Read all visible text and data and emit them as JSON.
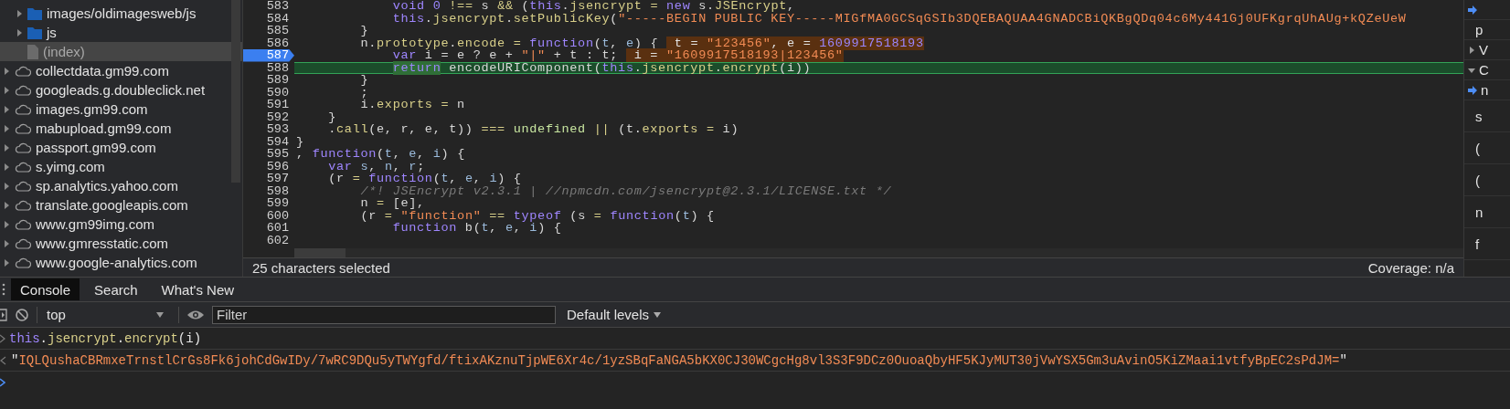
{
  "sidebar": {
    "items": [
      {
        "kind": "folder",
        "label": "images/oldimagesweb/js",
        "expanded": false,
        "selected": false
      },
      {
        "kind": "folder",
        "label": "js",
        "expanded": false,
        "selected": false
      },
      {
        "kind": "file",
        "label": "(index)",
        "selected": true
      },
      {
        "kind": "domain",
        "label": "collectdata.gm99.com",
        "expanded": false,
        "selected": false
      },
      {
        "kind": "domain",
        "label": "googleads.g.doubleclick.net",
        "expanded": false,
        "selected": false
      },
      {
        "kind": "domain",
        "label": "images.gm99.com",
        "expanded": false,
        "selected": false
      },
      {
        "kind": "domain",
        "label": "mabupload.gm99.com",
        "expanded": false,
        "selected": false
      },
      {
        "kind": "domain",
        "label": "passport.gm99.com",
        "expanded": false,
        "selected": false
      },
      {
        "kind": "domain",
        "label": "s.yimg.com",
        "expanded": false,
        "selected": false
      },
      {
        "kind": "domain",
        "label": "sp.analytics.yahoo.com",
        "expanded": false,
        "selected": false
      },
      {
        "kind": "domain",
        "label": "translate.googleapis.com",
        "expanded": false,
        "selected": false
      },
      {
        "kind": "domain",
        "label": "www.gm99img.com",
        "expanded": false,
        "selected": false
      },
      {
        "kind": "domain",
        "label": "www.gmresstatic.com",
        "expanded": false,
        "selected": false
      },
      {
        "kind": "domain",
        "label": "www.google-analytics.com",
        "expanded": false,
        "selected": false
      }
    ]
  },
  "editor": {
    "lines": [
      {
        "number": "583",
        "breakpoint": false,
        "paused": false,
        "tokens": [
          {
            "kind": "keyword",
            "text": "            void"
          },
          {
            "kind": "number",
            "text": " 0"
          },
          {
            "kind": "operator",
            "text": " !== "
          },
          {
            "kind": "plain",
            "text": "s"
          },
          {
            "kind": "operator",
            "text": " && "
          },
          {
            "kind": "plain",
            "text": "("
          },
          {
            "kind": "keyword",
            "text": "this"
          },
          {
            "kind": "plain",
            "text": "."
          },
          {
            "kind": "property",
            "text": "jsencrypt"
          },
          {
            "kind": "operator",
            "text": " = "
          },
          {
            "kind": "keyword",
            "text": "new"
          },
          {
            "kind": "plain",
            "text": " s."
          },
          {
            "kind": "property",
            "text": "JSEncrypt"
          },
          {
            "kind": "plain",
            "text": ","
          }
        ]
      },
      {
        "number": "584",
        "breakpoint": false,
        "paused": false,
        "tokens": [
          {
            "kind": "keyword",
            "text": "            this"
          },
          {
            "kind": "plain",
            "text": "."
          },
          {
            "kind": "property",
            "text": "jsencrypt"
          },
          {
            "kind": "plain",
            "text": "."
          },
          {
            "kind": "property",
            "text": "setPublicKey"
          },
          {
            "kind": "plain",
            "text": "("
          },
          {
            "kind": "string",
            "text": "\"-----BEGIN PUBLIC KEY-----MIGfMA0GCSqGSIb3DQEBAQUAA4GNADCBiQKBgQDq04c6My441Gj0UFKgrqUhAUg+kQZeUeW"
          }
        ]
      },
      {
        "number": "585",
        "breakpoint": false,
        "paused": false,
        "tokens": [
          {
            "kind": "plain",
            "text": "        }"
          }
        ]
      },
      {
        "number": "586",
        "breakpoint": false,
        "paused": false,
        "tokens": [
          {
            "kind": "plain",
            "text": "        n."
          },
          {
            "kind": "property",
            "text": "prototype"
          },
          {
            "kind": "plain",
            "text": "."
          },
          {
            "kind": "property",
            "text": "encode"
          },
          {
            "kind": "operator",
            "text": " = "
          },
          {
            "kind": "keyword",
            "text": "function"
          },
          {
            "kind": "plain",
            "text": "("
          },
          {
            "kind": "variable",
            "text": "t"
          },
          {
            "kind": "plain",
            "text": ", "
          },
          {
            "kind": "variable",
            "text": "e"
          },
          {
            "kind": "plain",
            "text": ") { "
          }
        ],
        "inline_value": [
          {
            "kind": "plain",
            "text": " t = "
          },
          {
            "kind": "string",
            "text": "\"123456\""
          },
          {
            "kind": "plain",
            "text": ", e = "
          },
          {
            "kind": "number",
            "text": "1609917518193"
          }
        ]
      },
      {
        "number": "587",
        "breakpoint": true,
        "paused": false,
        "tokens": [
          {
            "kind": "keyword",
            "text": "            var"
          },
          {
            "kind": "plain",
            "text": " i = e ? e + "
          },
          {
            "kind": "string",
            "text": "\"|\""
          },
          {
            "kind": "plain",
            "text": " + t : t; "
          }
        ],
        "inline_value": [
          {
            "kind": "plain",
            "text": " i = "
          },
          {
            "kind": "string",
            "text": "\"1609917518193|123456\""
          }
        ]
      },
      {
        "number": "588",
        "breakpoint": false,
        "paused": true,
        "tokens": [
          {
            "kind": "keyword",
            "text": "            return",
            "highlighted": true
          },
          {
            "kind": "plain",
            "text": " encodeURIComponent("
          },
          {
            "kind": "keyword",
            "text": "this"
          },
          {
            "kind": "plain",
            "text": "."
          },
          {
            "kind": "property",
            "text": "jsencrypt"
          },
          {
            "kind": "plain",
            "text": "."
          },
          {
            "kind": "property",
            "text": "encrypt"
          },
          {
            "kind": "plain",
            "text": "(i))"
          }
        ]
      },
      {
        "number": "589",
        "breakpoint": false,
        "paused": false,
        "tokens": [
          {
            "kind": "plain",
            "text": "        }"
          }
        ]
      },
      {
        "number": "590",
        "breakpoint": false,
        "paused": false,
        "tokens": [
          {
            "kind": "plain",
            "text": "        ;"
          }
        ]
      },
      {
        "number": "591",
        "breakpoint": false,
        "paused": false,
        "tokens": [
          {
            "kind": "plain",
            "text": "        i."
          },
          {
            "kind": "property",
            "text": "exports"
          },
          {
            "kind": "operator",
            "text": " = "
          },
          {
            "kind": "plain",
            "text": "n"
          }
        ]
      },
      {
        "number": "592",
        "breakpoint": false,
        "paused": false,
        "tokens": [
          {
            "kind": "plain",
            "text": "    }"
          }
        ]
      },
      {
        "number": "593",
        "breakpoint": false,
        "paused": false,
        "tokens": [
          {
            "kind": "plain",
            "text": "    ."
          },
          {
            "kind": "property",
            "text": "call"
          },
          {
            "kind": "plain",
            "text": "(e, r, e, t)) "
          },
          {
            "kind": "operator",
            "text": "==="
          },
          {
            "kind": "literal",
            "text": " undefined "
          },
          {
            "kind": "operator",
            "text": "||"
          },
          {
            "kind": "plain",
            "text": " (t."
          },
          {
            "kind": "property",
            "text": "exports"
          },
          {
            "kind": "operator",
            "text": " = "
          },
          {
            "kind": "plain",
            "text": "i)"
          }
        ]
      },
      {
        "number": "594",
        "breakpoint": false,
        "paused": false,
        "tokens": [
          {
            "kind": "plain",
            "text": "}"
          }
        ]
      },
      {
        "number": "595",
        "breakpoint": false,
        "paused": false,
        "tokens": [
          {
            "kind": "plain",
            "text": ", "
          },
          {
            "kind": "keyword",
            "text": "function"
          },
          {
            "kind": "plain",
            "text": "("
          },
          {
            "kind": "variable",
            "text": "t"
          },
          {
            "kind": "plain",
            "text": ", "
          },
          {
            "kind": "variable",
            "text": "e"
          },
          {
            "kind": "plain",
            "text": ", "
          },
          {
            "kind": "variable",
            "text": "i"
          },
          {
            "kind": "plain",
            "text": ") {"
          }
        ]
      },
      {
        "number": "596",
        "breakpoint": false,
        "paused": false,
        "tokens": [
          {
            "kind": "keyword",
            "text": "    var"
          },
          {
            "kind": "variable",
            "text": " s"
          },
          {
            "kind": "plain",
            "text": ", "
          },
          {
            "kind": "variable",
            "text": "n"
          },
          {
            "kind": "plain",
            "text": ", "
          },
          {
            "kind": "variable",
            "text": "r"
          },
          {
            "kind": "plain",
            "text": ";"
          }
        ]
      },
      {
        "number": "597",
        "breakpoint": false,
        "paused": false,
        "tokens": [
          {
            "kind": "plain",
            "text": "    (r "
          },
          {
            "kind": "operator",
            "text": "="
          },
          {
            "kind": "keyword",
            "text": " function"
          },
          {
            "kind": "plain",
            "text": "("
          },
          {
            "kind": "variable",
            "text": "t"
          },
          {
            "kind": "plain",
            "text": ", "
          },
          {
            "kind": "variable",
            "text": "e"
          },
          {
            "kind": "plain",
            "text": ", "
          },
          {
            "kind": "variable",
            "text": "i"
          },
          {
            "kind": "plain",
            "text": ") {"
          }
        ]
      },
      {
        "number": "598",
        "breakpoint": false,
        "paused": false,
        "tokens": [
          {
            "kind": "comment",
            "text": "        /*! JSEncrypt v2.3.1 | //npmcdn.com/jsencrypt@2.3.1/LICENSE.txt */"
          }
        ]
      },
      {
        "number": "599",
        "breakpoint": false,
        "paused": false,
        "tokens": [
          {
            "kind": "plain",
            "text": "        n "
          },
          {
            "kind": "operator",
            "text": "="
          },
          {
            "kind": "plain",
            "text": " [e],"
          }
        ]
      },
      {
        "number": "600",
        "breakpoint": false,
        "paused": false,
        "tokens": [
          {
            "kind": "plain",
            "text": "        (r "
          },
          {
            "kind": "operator",
            "text": "="
          },
          {
            "kind": "string",
            "text": " \"function\""
          },
          {
            "kind": "operator",
            "text": " == "
          },
          {
            "kind": "keyword",
            "text": "typeof"
          },
          {
            "kind": "plain",
            "text": " (s "
          },
          {
            "kind": "operator",
            "text": "="
          },
          {
            "kind": "keyword",
            "text": " function"
          },
          {
            "kind": "plain",
            "text": "("
          },
          {
            "kind": "variable",
            "text": "t"
          },
          {
            "kind": "plain",
            "text": ") {"
          }
        ]
      },
      {
        "number": "601",
        "breakpoint": false,
        "paused": false,
        "tokens": [
          {
            "kind": "keyword",
            "text": "            function"
          },
          {
            "kind": "plain",
            "text": " b("
          },
          {
            "kind": "variable",
            "text": "t"
          },
          {
            "kind": "plain",
            "text": ", "
          },
          {
            "kind": "variable",
            "text": "e"
          },
          {
            "kind": "plain",
            "text": ", "
          },
          {
            "kind": "variable",
            "text": "i"
          },
          {
            "kind": "plain",
            "text": ") {"
          }
        ]
      },
      {
        "number": "602",
        "breakpoint": false,
        "paused": false
      }
    ]
  },
  "status_bar": {
    "selection": "25 characters selected",
    "coverage": "Coverage: n/a"
  },
  "right_panel": {
    "rows": [
      {
        "kind": "current"
      },
      {
        "kind": "plain",
        "text": "p"
      },
      {
        "kind": "section",
        "text": "V",
        "expanded": false
      },
      {
        "kind": "section",
        "text": "C",
        "expanded": true
      },
      {
        "kind": "current",
        "text": "n"
      },
      {
        "kind": "plain",
        "text": "s"
      },
      {
        "kind": "frame",
        "text": "("
      },
      {
        "kind": "frame",
        "text": "("
      },
      {
        "kind": "frame",
        "text": "n"
      },
      {
        "kind": "frame",
        "text": "f"
      }
    ]
  },
  "drawer": {
    "tabs": [
      {
        "label": "Console",
        "selected": true
      },
      {
        "label": "Search",
        "selected": false
      },
      {
        "label": "What's New",
        "selected": false
      }
    ],
    "toolbar": {
      "context": "top",
      "filter": {
        "placeholder": "Filter"
      },
      "levels": "Default levels"
    },
    "console": [
      {
        "kind": "input",
        "tokens": [
          {
            "kind": "keyword",
            "text": "this"
          },
          {
            "kind": "plain",
            "text": "."
          },
          {
            "kind": "property",
            "text": "jsencrypt"
          },
          {
            "kind": "plain",
            "text": "."
          },
          {
            "kind": "property",
            "text": "encrypt"
          },
          {
            "kind": "plain",
            "text": "(i)"
          }
        ]
      },
      {
        "kind": "result",
        "tokens": [
          {
            "kind": "plain",
            "text": "\""
          },
          {
            "kind": "string",
            "text": "IQLQushaCBRmxeTrnstlCrGs8Fk6johCdGwIDy/7wRC9DQu5yTWYgfd/ftixAKznuTjpWE6Xr4c/1yzSBqFaNGA5bKX0CJ30WCgcHg8vl3S3F9DCz0OuoaQbyHF5KJyMUT30jVwYSX5Gm3uAvinO5KiZMaai1vtfyBpEC2sPdJM="
          },
          {
            "kind": "plain",
            "text": "\""
          }
        ]
      }
    ]
  }
}
